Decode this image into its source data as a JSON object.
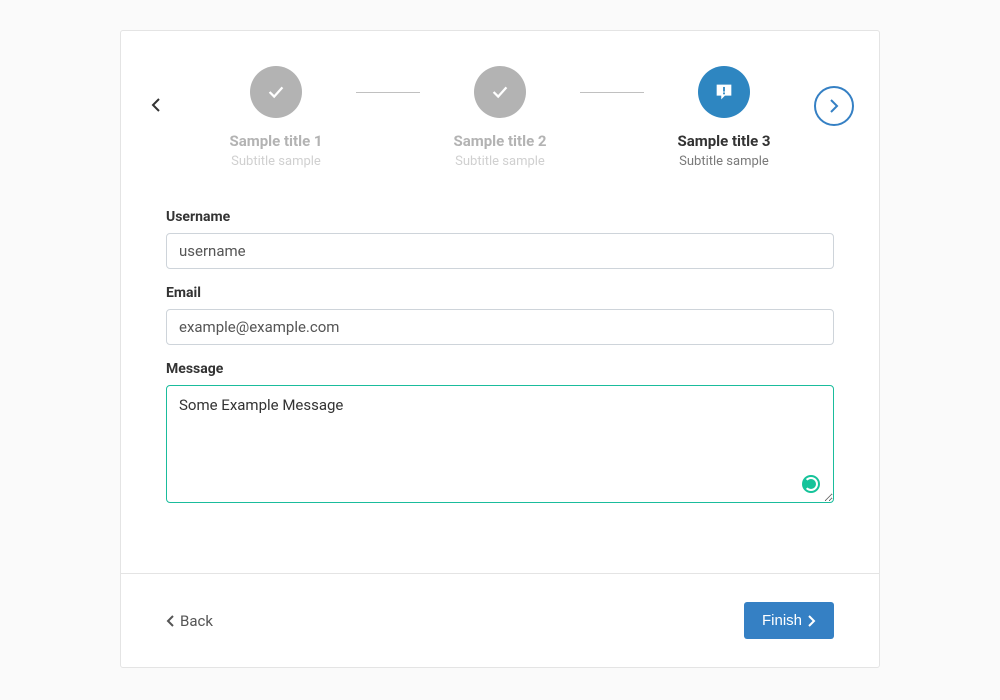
{
  "steps": [
    {
      "title": "Sample title 1",
      "subtitle": "Subtitle sample",
      "state": "done"
    },
    {
      "title": "Sample title 2",
      "subtitle": "Subtitle sample",
      "state": "done"
    },
    {
      "title": "Sample title 3",
      "subtitle": "Subtitle sample",
      "state": "active"
    }
  ],
  "form": {
    "username": {
      "label": "Username",
      "value": "username"
    },
    "email": {
      "label": "Email",
      "value": "example@example.com"
    },
    "message": {
      "label": "Message",
      "value": "Some Example Message"
    }
  },
  "footer": {
    "back_label": "Back",
    "finish_label": "Finish"
  },
  "colors": {
    "primary": "#3580c4",
    "accent": "#1abc9c",
    "muted": "#b3b3b3"
  }
}
